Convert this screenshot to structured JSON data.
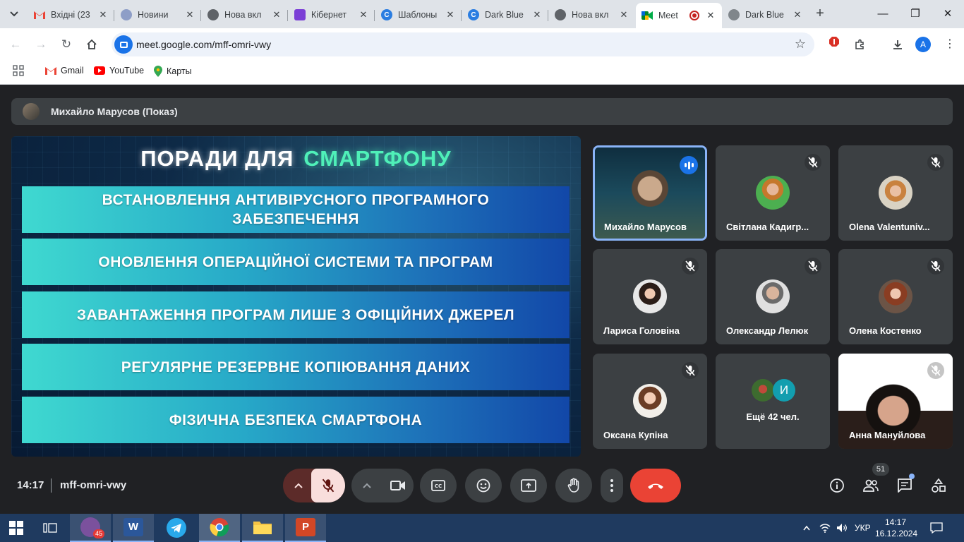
{
  "browser": {
    "tabs": [
      {
        "title": "Вхідні (23",
        "favicon": "gmail-icon"
      },
      {
        "title": "Новини",
        "favicon": "news-icon"
      },
      {
        "title": "Нова вкл",
        "favicon": "chrome-icon"
      },
      {
        "title": "Кібернет",
        "favicon": "course-icon"
      },
      {
        "title": "Шаблоны",
        "favicon": "canva-icon"
      },
      {
        "title": "Dark Blue",
        "favicon": "canva-icon"
      },
      {
        "title": "Нова вкл",
        "favicon": "chrome-icon"
      },
      {
        "title": "Meet",
        "favicon": "meet-icon",
        "active": true
      },
      {
        "title": "Dark Blue",
        "favicon": "globe-icon"
      }
    ],
    "url": "meet.google.com/mff-omri-vwy",
    "profile_initial": "A",
    "bookmarks": [
      {
        "label": "Gmail"
      },
      {
        "label": "YouTube"
      },
      {
        "label": "Карты"
      }
    ]
  },
  "meet": {
    "presenter_label": "Михайло Марусов (Показ)",
    "slide": {
      "title_part1": "ПОРАДИ ДЛЯ",
      "title_part2": "СМАРТФОНУ",
      "items": [
        "ВСТАНОВЛЕННЯ АНТИВІРУСНОГО ПРОГРАМНОГО ЗАБЕЗПЕЧЕННЯ",
        "ОНОВЛЕННЯ ОПЕРАЦІЙНОЇ СИСТЕМИ ТА ПРОГРАМ",
        "ЗАВАНТАЖЕННЯ ПРОГРАМ ЛИШЕ З ОФІЦІЙНИХ ДЖЕРЕЛ",
        "РЕГУЛЯРНЕ РЕЗЕРВНЕ КОПІЮВАННЯ ДАНИХ",
        "ФІЗИЧНА БЕЗПЕКА СМАРТФОНА"
      ]
    },
    "participants": [
      {
        "name": "Михайло Марусов",
        "speaking": true
      },
      {
        "name": "Світлана Кадигр...",
        "muted": true
      },
      {
        "name": "Olena Valentuniv...",
        "muted": true
      },
      {
        "name": "Лариса Головіна",
        "muted": true
      },
      {
        "name": "Олександр Лелюк",
        "muted": true
      },
      {
        "name": "Олена Костенко",
        "muted": true
      },
      {
        "name": "Оксана Купіна",
        "muted": true
      },
      {
        "name": "Ещё 42 чел.",
        "avatar_initial": "И"
      },
      {
        "name": "Анна Мануйлова",
        "muted": true
      }
    ],
    "time": "14:17",
    "meeting_code": "mff-omri-vwy",
    "participant_count": "51"
  },
  "taskbar": {
    "viber_badge": "45",
    "language": "УКР",
    "time": "14:17",
    "date": "16.12.2024"
  },
  "colors": {
    "meet_bg": "#202124",
    "tile_bg": "#3c4043",
    "end_call": "#ea4335",
    "accent_blue": "#8ab4f8",
    "slide_title_green": "#4ff0b8"
  }
}
